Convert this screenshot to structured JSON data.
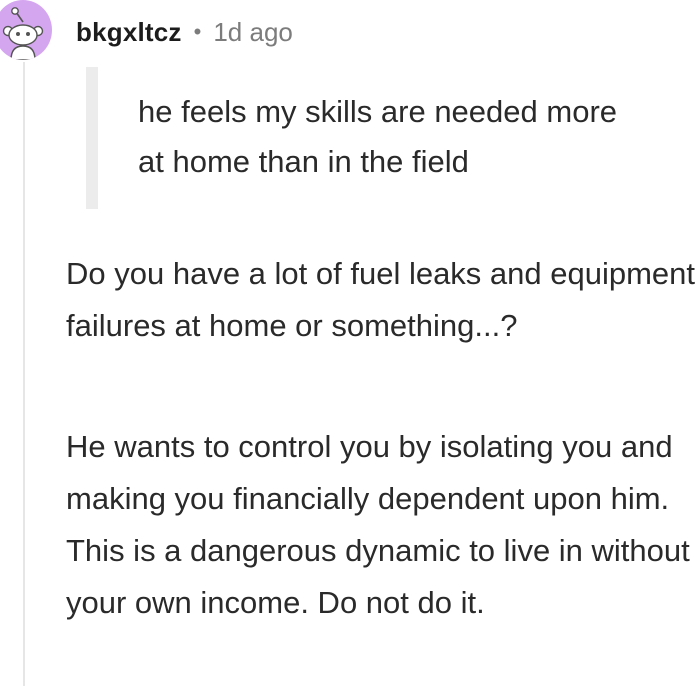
{
  "comment": {
    "username": "bkgxltcz",
    "separator": "•",
    "time": "1d ago",
    "quote": "he feels my skills are needed more at home than in the field",
    "paragraphs": [
      "Do you have a lot of fuel leaks and equipment failures at home or something...?",
      "He wants to control you by isolating you and making you financially dependent upon him. This is a dangerous dynamic to live in without your own income. Do not do it."
    ]
  },
  "colors": {
    "avatar_bg": "#d5a6f0",
    "meta_text": "#7c7c7c",
    "quote_bar": "#ececec",
    "thread_line": "#e6e6e6"
  },
  "icons": {
    "avatar": "snoo-avatar-icon"
  }
}
